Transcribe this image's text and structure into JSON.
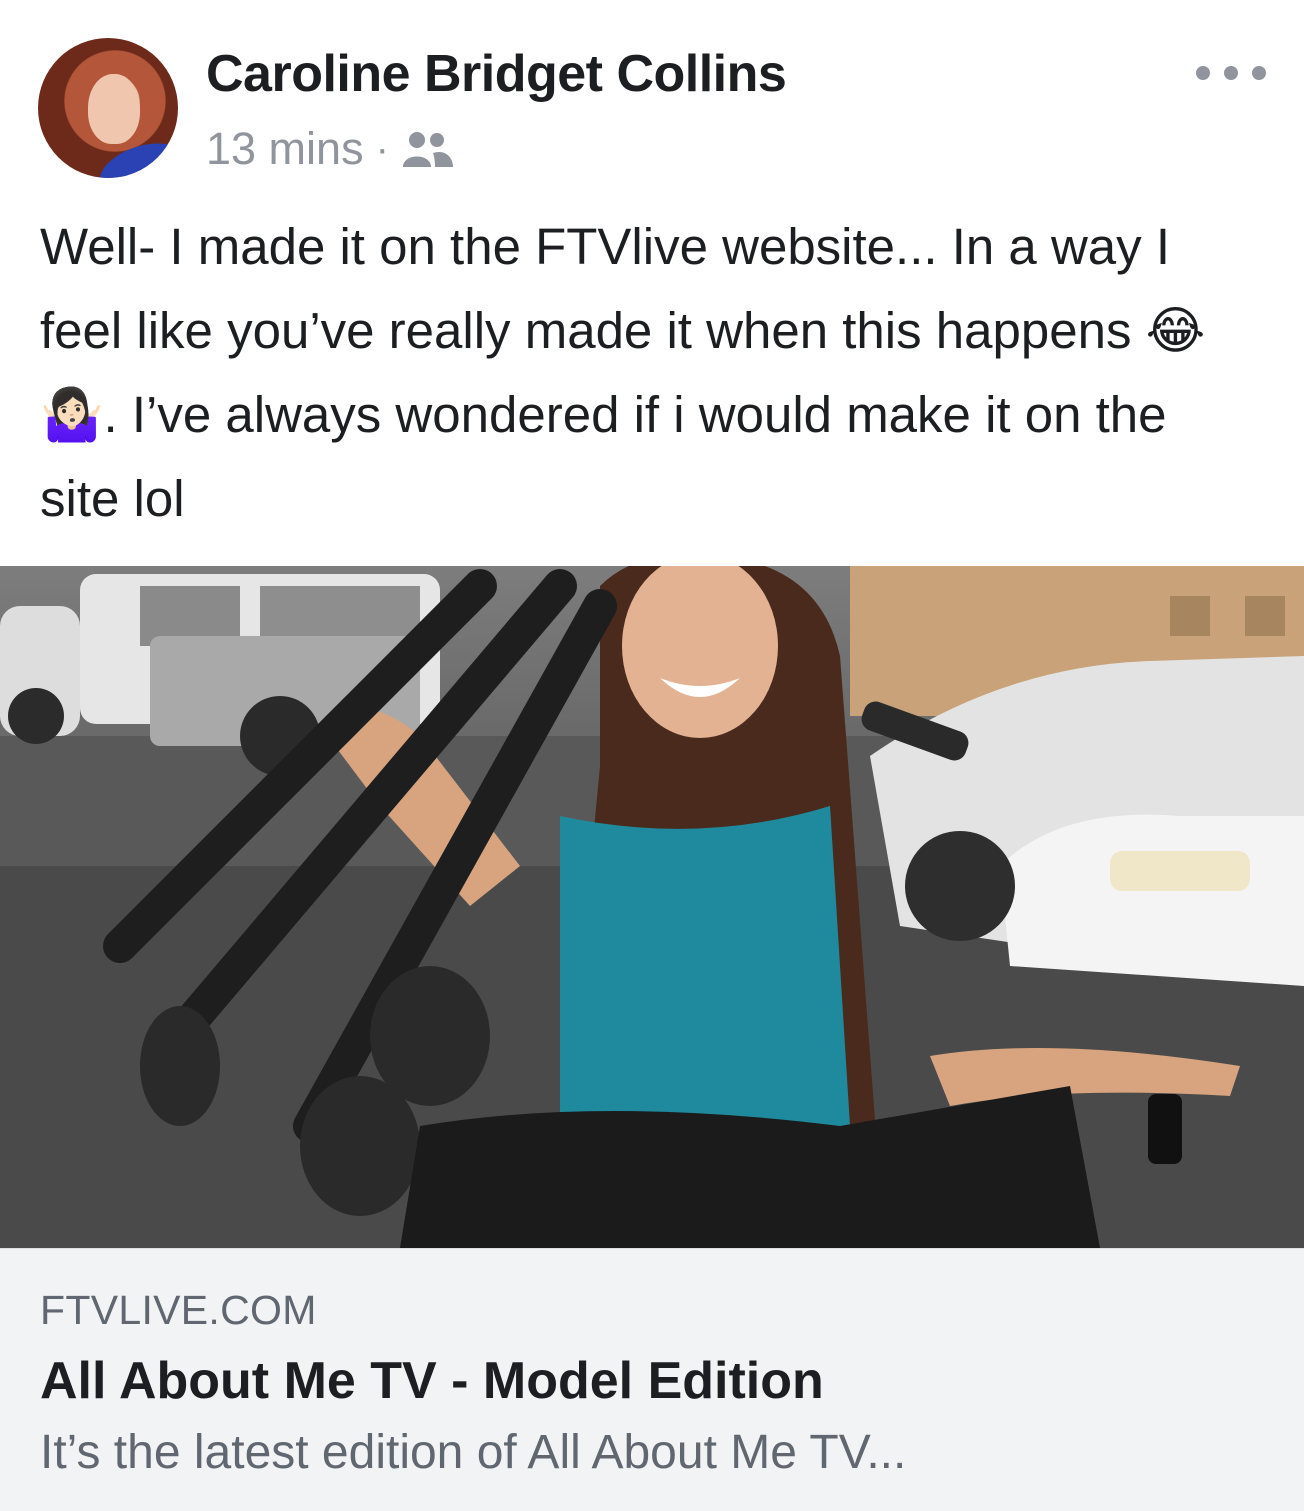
{
  "post": {
    "author": "Caroline Bridget Collins",
    "timestamp": "13 mins",
    "separator": "·",
    "audience_icon": "friends-icon",
    "more_icon": "more-options-icon",
    "text": "Well- I made it on the FTVlive website... In a way I feel like you’ve really made it when this happens 😂🤷🏻‍♀️.  I’ve always wondered if i would make it on the site lol"
  },
  "link": {
    "domain": "FTVLIVE.COM",
    "title": "All About Me TV - Model Edition",
    "description": "It’s the latest edition of All About Me TV..."
  },
  "colors": {
    "text_primary": "#1c1e21",
    "text_secondary": "#90949c",
    "link_bg": "#f2f3f5"
  }
}
